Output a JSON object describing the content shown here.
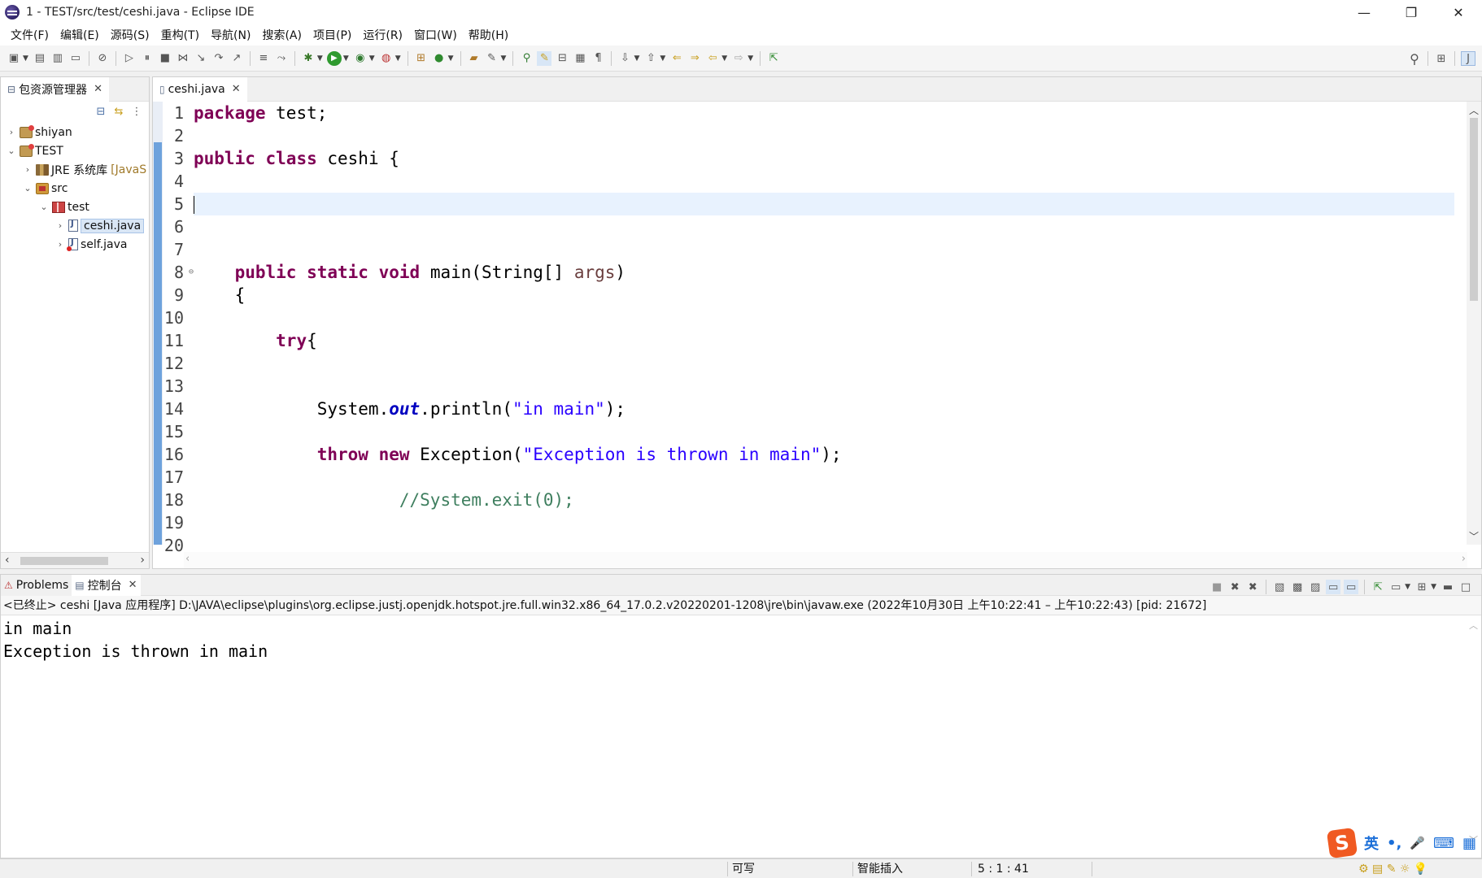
{
  "window": {
    "title": "1 - TEST/src/test/ceshi.java - Eclipse IDE",
    "minimize_glyph": "—",
    "maximize_glyph": "❐",
    "close_glyph": "✕"
  },
  "menu": {
    "items": [
      "文件(F)",
      "编辑(E)",
      "源码(S)",
      "重构(T)",
      "导航(N)",
      "搜索(A)",
      "项目(P)",
      "运行(R)",
      "窗口(W)",
      "帮助(H)"
    ]
  },
  "package_explorer": {
    "tab_label": "包资源管理器",
    "tree": [
      {
        "label": "shiyan",
        "twisty": "›",
        "icon": "project"
      },
      {
        "label": "TEST",
        "twisty": "⌄",
        "icon": "project"
      },
      {
        "label": "JRE 系统库",
        "suffix": "[JavaS",
        "twisty": "›",
        "icon": "library"
      },
      {
        "label": "src",
        "twisty": "⌄",
        "icon": "source-folder"
      },
      {
        "label": "test",
        "twisty": "⌄",
        "icon": "package"
      },
      {
        "label": "ceshi.java",
        "twisty": "›",
        "icon": "java-file",
        "selected": true
      },
      {
        "label": "self.java",
        "twisty": "›",
        "icon": "java-file-error"
      }
    ]
  },
  "editor": {
    "tab_label": "ceshi.java",
    "line_numbers": [
      "1",
      "2",
      "3",
      "4",
      "5",
      "6",
      "7",
      "8",
      "9",
      "10",
      "11",
      "12",
      "13",
      "14",
      "15",
      "16",
      "17",
      "18",
      "19",
      "20"
    ],
    "fold_marker": "⊖",
    "code": {
      "l1_kw": "package",
      "l1_rest": " test;",
      "l3_kw1": "public",
      "l3_kw2": "class",
      "l3_rest": " ceshi {",
      "l8_kw1": "public",
      "l8_kw2": "static",
      "l8_kw3": "void",
      "l8_mid": " main(String[] ",
      "l8_param": "args",
      "l8_end": ")",
      "l9": "{",
      "l11_kw": "try",
      "l11_rest": "{",
      "l14_a": "System.",
      "l14_field": "out",
      "l14_b": ".println(",
      "l14_str": "\"in main\"",
      "l14_end": ");",
      "l16_kw1": "throw",
      "l16_kw2": "new",
      "l16_mid": " Exception(",
      "l16_str": "\"Exception is thrown in main\"",
      "l16_end": ");",
      "l18_cmt": "//System.exit(0);"
    }
  },
  "console": {
    "problems_tab": "Problems",
    "console_tab": "控制台",
    "info": "<已终止> ceshi [Java 应用程序] D:\\JAVA\\eclipse\\plugins\\org.eclipse.justj.openjdk.hotspot.jre.full.win32.x86_64_17.0.2.v20220201-1208\\jre\\bin\\javaw.exe  (2022年10月30日 上午10:22:41 – 上午10:22:43) [pid: 21672]",
    "output": [
      "in main",
      "Exception is thrown in main"
    ]
  },
  "status": {
    "writable": "可写",
    "insert_mode": "智能插入",
    "position": "5 : 1 : 41"
  },
  "ime": {
    "logo": "S",
    "lang": "英",
    "punct": "•,",
    "mic": "🎤",
    "keyboard": "⌨",
    "grid": "▦"
  }
}
